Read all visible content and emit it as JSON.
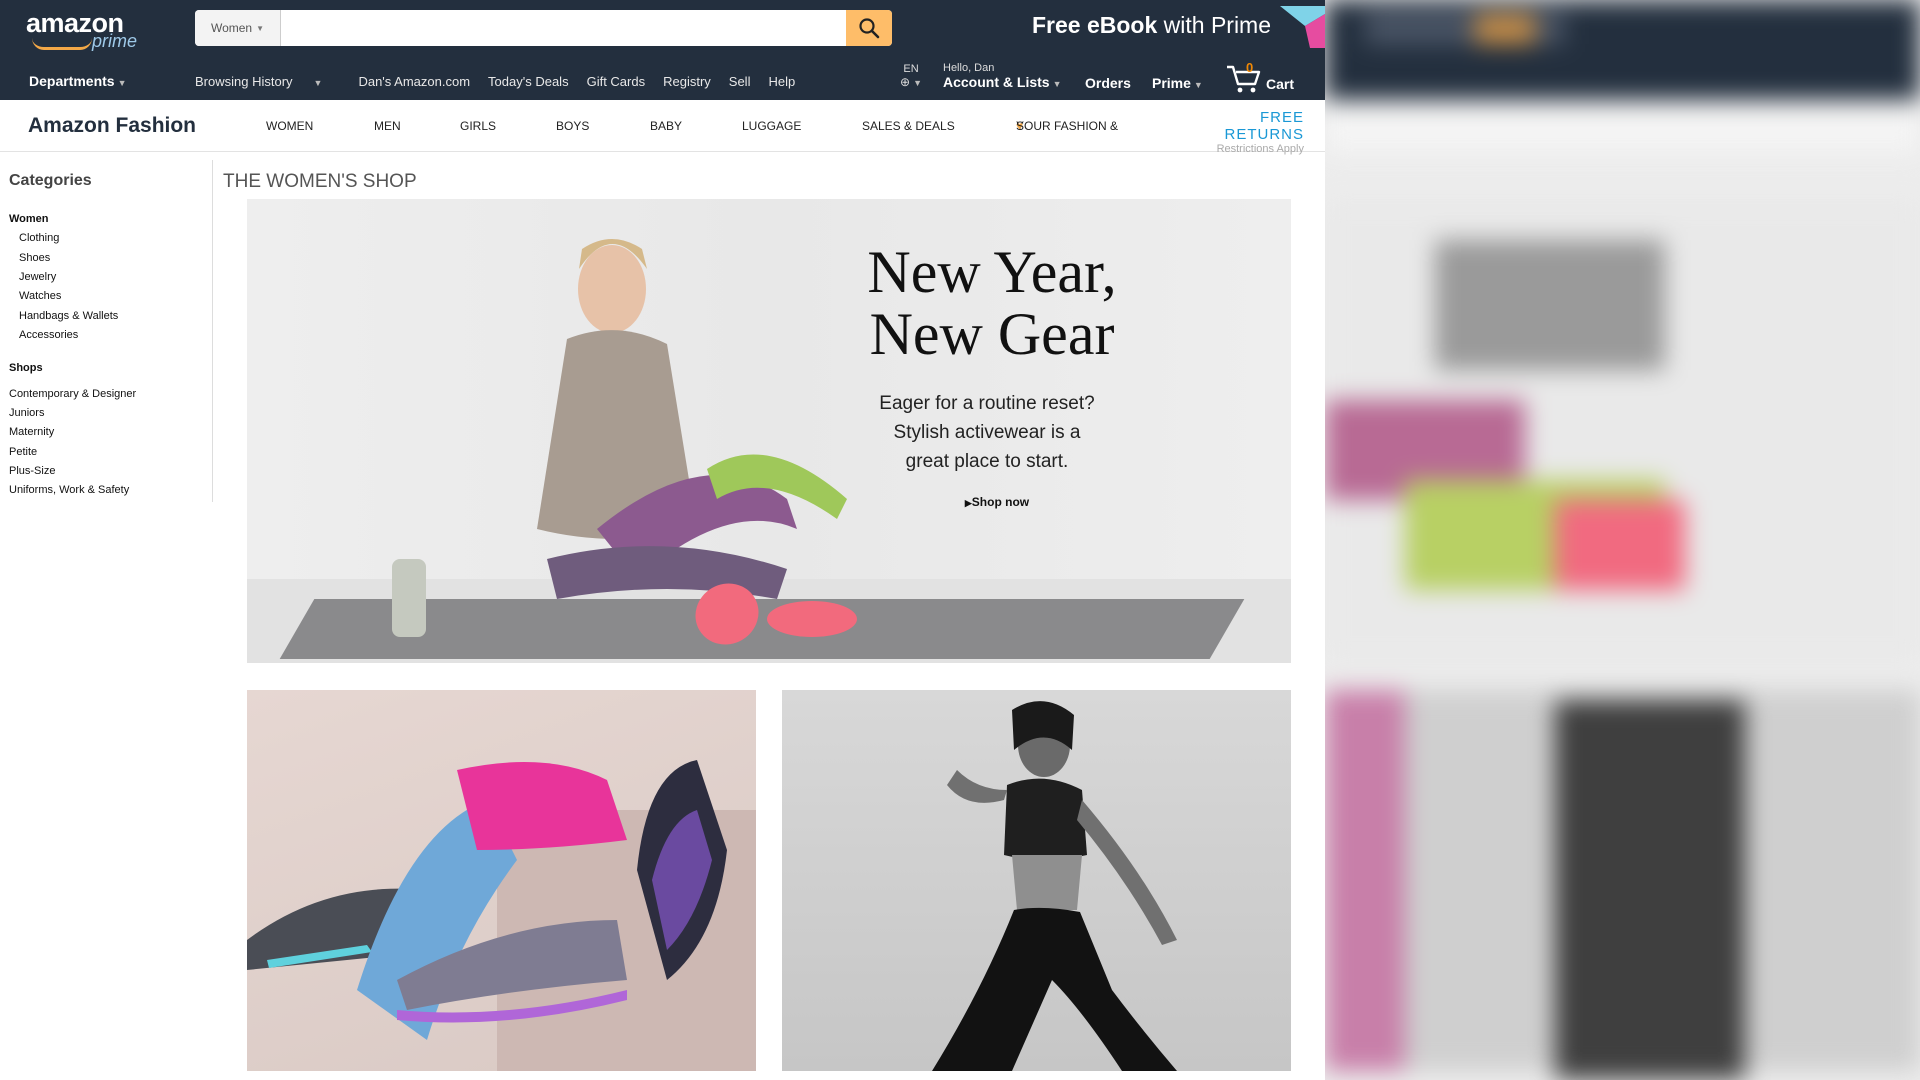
{
  "header": {
    "logo_main": "amazon",
    "logo_sub": "prime",
    "search_dept": "Women",
    "search_placeholder": "",
    "prime_promo_bold": "Free eBook",
    "prime_promo_rest": " with Prime",
    "departments": "Departments",
    "nav_links": [
      "Browsing History",
      "Dan's Amazon.com",
      "Today's Deals",
      "Gift Cards",
      "Registry",
      "Sell",
      "Help"
    ],
    "lang": "EN",
    "greeting": "Hello, Dan",
    "account": "Account & Lists",
    "orders": "Orders",
    "prime": "Prime",
    "cart_count": "0",
    "cart": "Cart"
  },
  "fashion": {
    "title": "Amazon Fashion",
    "nav": [
      "WOMEN",
      "MEN",
      "GIRLS",
      "BOYS",
      "BABY",
      "LUGGAGE",
      "SALES & DEALS",
      "YOUR FASHION & ",
      "S"
    ],
    "free_returns": "FREE RETURNS",
    "restrictions": "Restrictions Apply"
  },
  "sidebar": {
    "heading": "Categories",
    "women_label": "Women",
    "women_items": [
      "Clothing",
      "Shoes",
      "Jewelry",
      "Watches",
      "Handbags & Wallets",
      "Accessories"
    ],
    "shops_label": "Shops",
    "shops_items": [
      "Contemporary & Designer",
      "Juniors",
      "Maternity",
      "Petite",
      "Plus-Size",
      "Uniforms, Work & Safety"
    ]
  },
  "main": {
    "shop_title": "THE WOMEN'S SHOP",
    "hero_line1": "New Year,",
    "hero_line2": "New Gear",
    "hero_sub1": "Eager for a routine reset?",
    "hero_sub2": "Stylish activewear is a",
    "hero_sub3": "great place to start.",
    "hero_cta": "Shop now"
  },
  "colors": {
    "topbar": "#232f3e",
    "search_button": "#febd69",
    "smile": "#f3a847",
    "free_returns": "#1a98d5",
    "cart_count": "#f08804"
  },
  "icons": [
    "search-icon",
    "globe-icon",
    "cart-icon",
    "heart-icon",
    "play-triangle-icon"
  ]
}
